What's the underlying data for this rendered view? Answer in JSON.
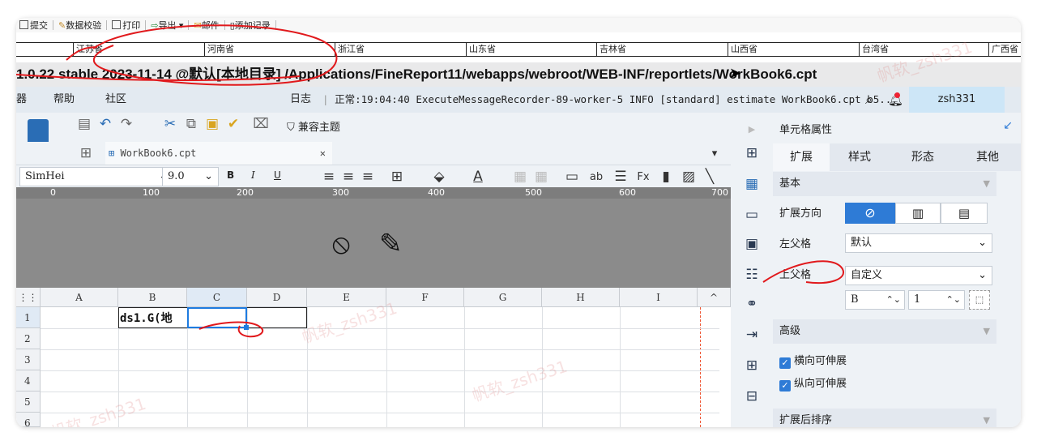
{
  "report_toolbar": {
    "items": [
      "提交",
      "数据校验",
      "打印",
      "导出",
      "邮件",
      "添加记录"
    ]
  },
  "provinces": [
    "江苏省",
    "河南省",
    "浙江省",
    "山东省",
    "吉林省",
    "山西省",
    "台湾省",
    "广西省"
  ],
  "title": "1.0.22 stable 2023-11-14 @默认[本地目录]   /Applications/FineReport11/webapps/webroot/WEB-INF/reportlets/WorkBook6.cpt",
  "menu": {
    "items": [
      "器",
      "帮助",
      "社区"
    ],
    "log_label": "日志",
    "log_text": "正常:19:04:40 ExecuteMessageRecorder-89-worker-5 INFO [standard] estimate WorkBook6.cpt b5...",
    "user": "zsh331"
  },
  "toolbar": {
    "theme_label": "兼容主题"
  },
  "tab": {
    "label": "WorkBook6.cpt"
  },
  "format": {
    "font": "SimHei",
    "size": "9.0",
    "bold": "B",
    "italic": "I",
    "underline": "U"
  },
  "ruler": [
    "0",
    "100",
    "200",
    "300",
    "400",
    "500",
    "600",
    "700"
  ],
  "grid": {
    "columns": [
      "A",
      "B",
      "C",
      "D",
      "E",
      "F",
      "G",
      "H",
      "I"
    ],
    "rows": [
      "1",
      "2",
      "3",
      "4",
      "5",
      "6"
    ],
    "cell_b1": "ds1.G(地"
  },
  "props": {
    "title": "单元格属性",
    "tabs": [
      "扩展",
      "样式",
      "形态",
      "其他"
    ],
    "basic": "基本",
    "expand_dir": "扩展方向",
    "left_parent": "左父格",
    "left_parent_value": "默认",
    "top_parent": "上父格",
    "top_parent_value": "自定义",
    "top_col": "B",
    "top_row": "1",
    "advanced": "高级",
    "h_expand": "横向可伸展",
    "v_expand": "纵向可伸展",
    "sort": "扩展后排序"
  },
  "watermark": [
    "帆软_zsh331",
    "帆软_zsh331",
    "帆软_zsh331",
    "帆软_zsh331"
  ],
  "colors": {
    "accent": "#2e7bd6",
    "selection": "#1e7be0",
    "annotation": "#e1191c",
    "user_bg": "#cde6f7"
  }
}
